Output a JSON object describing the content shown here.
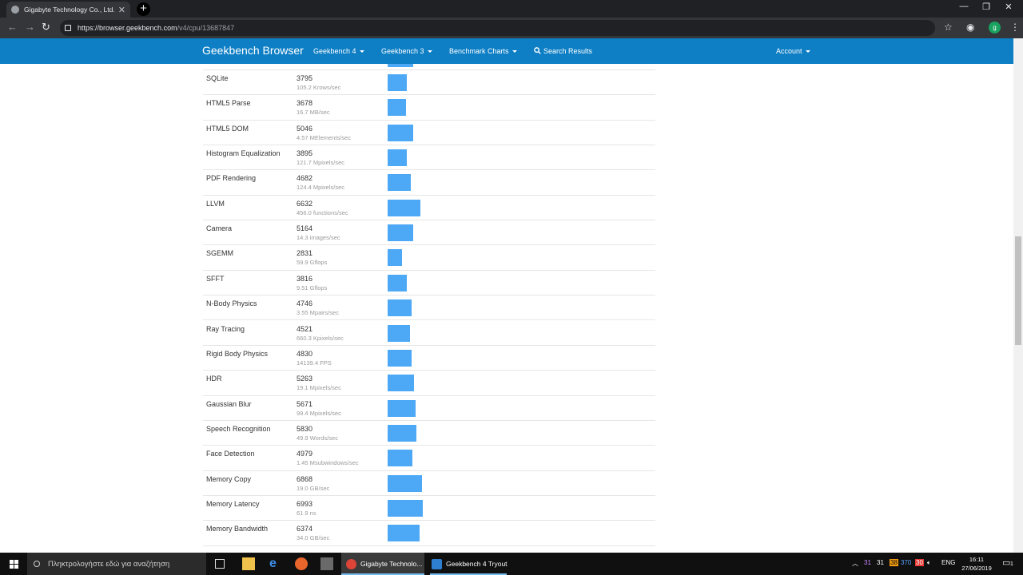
{
  "browser": {
    "tab_title": "Gigabyte Technology Co., Ltd. X4",
    "url_host": "https://browser.geekbench.com",
    "url_path": "/v4/cpu/13687847",
    "profile_initial": "g"
  },
  "site_nav": {
    "brand": "Geekbench Browser",
    "items": [
      "Geekbench 4",
      "Geekbench 3",
      "Benchmark Charts",
      "Search Results"
    ],
    "account": "Account"
  },
  "results": {
    "max_score": 7200,
    "rows": [
      {
        "name": "SQLite",
        "score": "3795",
        "detail": "105.2 Krows/sec",
        "value": 3795
      },
      {
        "name": "HTML5 Parse",
        "score": "3678",
        "detail": "16.7 MB/sec",
        "value": 3678
      },
      {
        "name": "HTML5 DOM",
        "score": "5046",
        "detail": "4.57 MElements/sec",
        "value": 5046
      },
      {
        "name": "Histogram Equalization",
        "score": "3895",
        "detail": "121.7 Mpixels/sec",
        "value": 3895
      },
      {
        "name": "PDF Rendering",
        "score": "4682",
        "detail": "124.4 Mpixels/sec",
        "value": 4682
      },
      {
        "name": "LLVM",
        "score": "6632",
        "detail": "456.0 functions/sec",
        "value": 6632
      },
      {
        "name": "Camera",
        "score": "5164",
        "detail": "14.3 images/sec",
        "value": 5164
      },
      {
        "name": "SGEMM",
        "score": "2831",
        "detail": "59.9 Gflops",
        "value": 2831
      },
      {
        "name": "SFFT",
        "score": "3816",
        "detail": "9.51 Gflops",
        "value": 3816
      },
      {
        "name": "N-Body Physics",
        "score": "4746",
        "detail": "3.55 Mpairs/sec",
        "value": 4746
      },
      {
        "name": "Ray Tracing",
        "score": "4521",
        "detail": "660.3 Kpixels/sec",
        "value": 4521
      },
      {
        "name": "Rigid Body Physics",
        "score": "4830",
        "detail": "14139.4 FPS",
        "value": 4830
      },
      {
        "name": "HDR",
        "score": "5263",
        "detail": "19.1 Mpixels/sec",
        "value": 5263
      },
      {
        "name": "Gaussian Blur",
        "score": "5671",
        "detail": "99.4 Mpixels/sec",
        "value": 5671
      },
      {
        "name": "Speech Recognition",
        "score": "5830",
        "detail": "49.9 Words/sec",
        "value": 5830
      },
      {
        "name": "Face Detection",
        "score": "4979",
        "detail": "1.45 Msubwindows/sec",
        "value": 4979
      },
      {
        "name": "Memory Copy",
        "score": "6868",
        "detail": "19.0 GB/sec",
        "value": 6868
      },
      {
        "name": "Memory Latency",
        "score": "6993",
        "detail": "61.9 ns",
        "value": 6993
      },
      {
        "name": "Memory Bandwidth",
        "score": "6374",
        "detail": "34.0 GB/sec",
        "value": 6374
      }
    ]
  },
  "taskbar": {
    "search_placeholder": "Πληκτρολογήστε εδώ για αναζήτηση",
    "tasks": [
      "Gigabyte Technolo...",
      "Geekbench 4 Tryout"
    ],
    "tray_items": [
      "31",
      "31",
      "38",
      "370",
      "30"
    ],
    "language": "ENG",
    "time": "16:11",
    "date": "27/06/2019",
    "notification_count": "1"
  },
  "colors": {
    "nav_bg": "#0e7fc5",
    "bar": "#4da9f5"
  }
}
